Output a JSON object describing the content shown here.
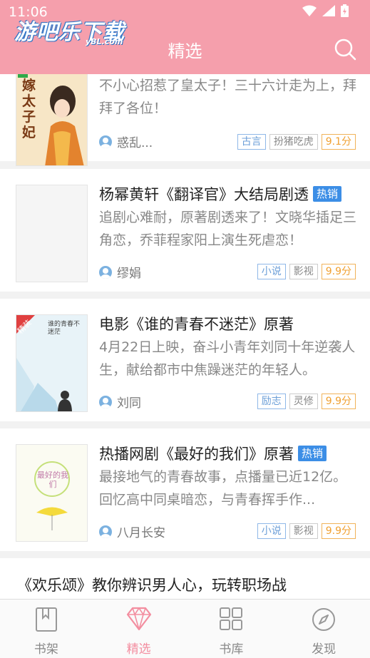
{
  "status": {
    "time": "11:06"
  },
  "logo": {
    "main": "游吧乐下载",
    "sub": "yBL.com"
  },
  "header": {
    "title": "精选"
  },
  "books": [
    {
      "title": "",
      "hot": "",
      "desc": "不小心招惹了皇太子！三十六计走为上，拜拜了各位！",
      "author": "惑乱...",
      "tags": [
        "古言",
        "扮猪吃虎"
      ],
      "score": "9.1分",
      "cover_text": "嫁太子妃"
    },
    {
      "title": "杨幂黄轩《翻译官》大结局剧透",
      "hot": "热销",
      "desc": "追剧心难耐，原著剧透来了！文晓华插足三角恋，乔菲程家阳上演生死虐恋！",
      "author": "缪娟",
      "tags": [
        "小说",
        "影视"
      ],
      "score": "9.9分"
    },
    {
      "title": "电影《谁的青春不迷茫》原著",
      "hot": "",
      "desc": "4月22日上映，奋斗小青年刘同十年逆袭人生，献给都市中焦躁迷茫的年轻人。",
      "author": "刘同",
      "tags": [
        "励志",
        "灵修"
      ],
      "score": "9.9分",
      "ribbon": "精装",
      "cover_text": "谁的青春不迷茫"
    },
    {
      "title": "热播网剧《最好的我们》原著",
      "hot": "热销",
      "desc": "最接地气的青春故事，点播量已近12亿。回忆高中同桌暗恋，与青春挥手作...",
      "author": "八月长安",
      "tags": [
        "小说",
        "影视"
      ],
      "score": "9.9分",
      "cover_text": "最好的我们"
    }
  ],
  "next_title": "《欢乐颂》教你辨识男人心，玩转职场战",
  "tabs": [
    {
      "label": "书架",
      "icon": "bookshelf-icon"
    },
    {
      "label": "精选",
      "icon": "diamond-icon"
    },
    {
      "label": "书库",
      "icon": "grid-icon"
    },
    {
      "label": "发现",
      "icon": "compass-icon"
    }
  ],
  "colors": {
    "header": "#f59fac",
    "accent": "#f38ea0",
    "hot_badge": "#3c8ee6",
    "score": "#f0a030"
  }
}
